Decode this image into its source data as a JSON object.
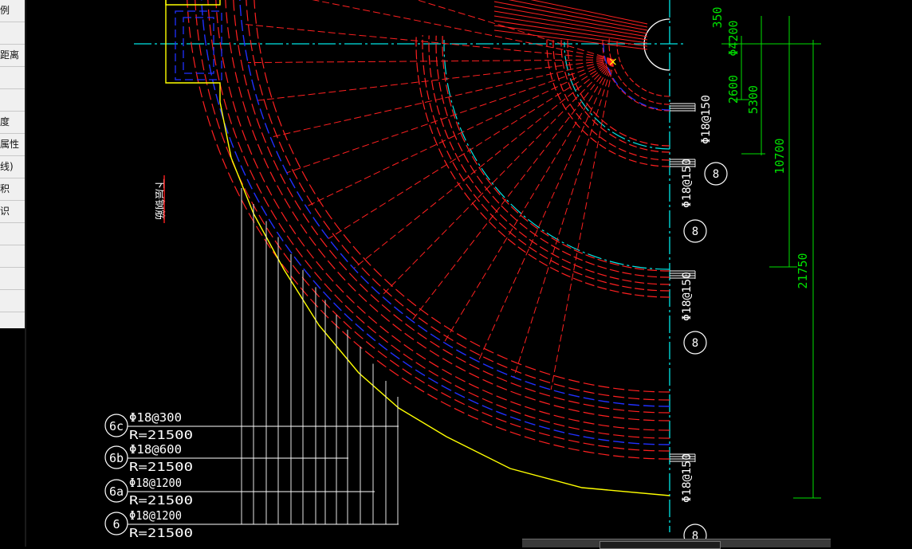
{
  "side_panel": {
    "items": [
      {
        "label": "例"
      },
      {
        "label": ""
      },
      {
        "label": "距离"
      },
      {
        "label": ""
      },
      {
        "label": ""
      },
      {
        "label": "度"
      },
      {
        "label": "属性"
      },
      {
        "label": "线)"
      },
      {
        "label": "积"
      },
      {
        "label": "识"
      },
      {
        "label": ""
      },
      {
        "label": ""
      },
      {
        "label": ""
      },
      {
        "label": ""
      },
      {
        "label": ""
      }
    ]
  },
  "drawing": {
    "colors": {
      "outline": "#ffff00",
      "rebar_red": "#ff2020",
      "rebar_blue": "#2030ff",
      "centerline": "#00e6e6",
      "annotation": "#ffffff",
      "dimension": "#00e000"
    },
    "side_note": "下层钢筋",
    "rebar_labels": [
      {
        "circle": "6c",
        "spec": "Φ18@300",
        "radius": "R=21500"
      },
      {
        "circle": "6b",
        "spec": "Φ18@600",
        "radius": "R=21500"
      },
      {
        "circle": "6a",
        "spec": "Φ18@1200",
        "radius": "R=21500"
      },
      {
        "circle": "6",
        "spec": "Φ18@1200",
        "radius": "R=21500"
      }
    ],
    "bar_marks": [
      {
        "circle": "8",
        "spec": "Φ18@150"
      },
      {
        "circle": "8",
        "spec": "Φ18@150"
      },
      {
        "circle": "8",
        "spec": "Φ18@150"
      },
      {
        "circle": "8",
        "spec": "Φ18@150"
      }
    ],
    "dimensions": [
      "350",
      "Φ4200",
      "2600",
      "5300",
      "10700",
      "21750"
    ]
  }
}
